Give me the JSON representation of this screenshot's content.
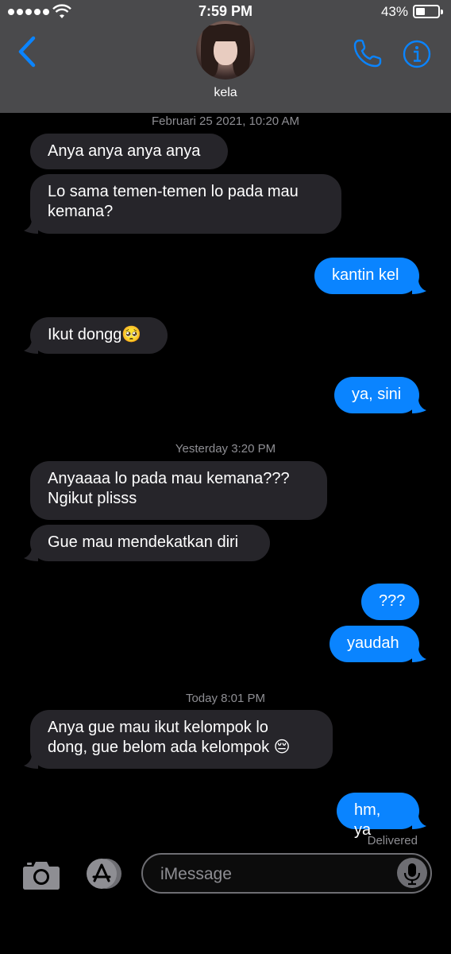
{
  "status_bar": {
    "time": "7:59 PM",
    "battery_percent": "43%",
    "signal_bars": 5,
    "battery_level": 0.43
  },
  "header": {
    "contact_name": "kela",
    "back_icon": "chevron-left-icon",
    "call_icon": "phone-icon",
    "info_icon": "info-icon"
  },
  "colors": {
    "accent": "#0a84ff",
    "incoming_bubble": "#26252a",
    "header_bg": "#4a4a4c"
  },
  "timestamps": {
    "t1": "Februari 25 2021, 10:20 AM",
    "t2": "Yesterday 3:20 PM",
    "t3": "Today 8:01 PM"
  },
  "messages": {
    "m1": "Anya anya anya anya",
    "m2": "Lo sama temen-temen lo pada mau\nkemana?",
    "m3": "kantin kel",
    "m4": "Ikut dongg🥺",
    "m5": "ya, sini",
    "m6": "Anyaaaa lo pada mau kemana???\nNgikut plisss",
    "m7": "Gue mau mendekatkan diri",
    "m8": "???",
    "m9": "yaudah",
    "m10": "Anya gue mau ikut kelompok lo\ndong, gue belom ada kelompok 😔",
    "m11": "hm, ya"
  },
  "delivery_status": "Delivered",
  "composer": {
    "placeholder": "iMessage",
    "camera_icon": "camera-icon",
    "apps_icon": "app-store-icon",
    "mic_icon": "microphone-icon"
  }
}
